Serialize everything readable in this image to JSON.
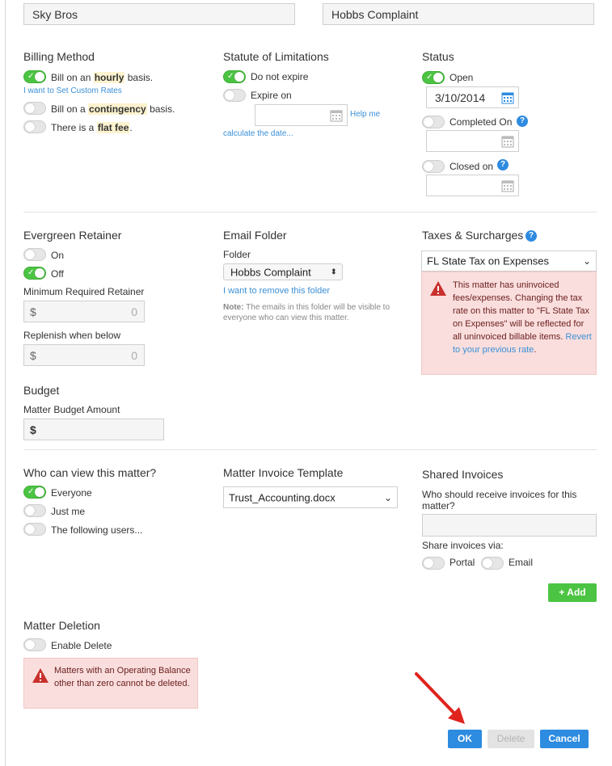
{
  "top": {
    "client_value": "Sky Bros",
    "matter_value": "Hobbs Complaint"
  },
  "billing": {
    "title": "Billing Method",
    "hourly_pre": "Bill on an",
    "hourly_kw": "hourly",
    "hourly_post": "basis.",
    "custom_rates_link": "I want to Set Custom Rates",
    "contingency_pre": "Bill on a",
    "contingency_kw": "contingency",
    "contingency_post": "basis.",
    "flat_pre": "There is a",
    "flat_kw": "flat fee",
    "flat_post": "."
  },
  "statute": {
    "title": "Statute of Limitations",
    "do_not_expire": "Do not expire",
    "expire_on": "Expire on",
    "help_link_1": "Help me",
    "help_link_2": "calculate the date..."
  },
  "status": {
    "title": "Status",
    "open_label": "Open",
    "open_date": "3/10/2014",
    "completed_label": "Completed On",
    "closed_label": "Closed on"
  },
  "evergreen": {
    "title": "Evergreen Retainer",
    "on_label": "On",
    "off_label": "Off",
    "min_label": "Minimum Required Retainer",
    "min_currency": "$",
    "min_value": "0",
    "replenish_label": "Replenish when below",
    "rep_currency": "$",
    "rep_value": "0"
  },
  "email_folder": {
    "title": "Email Folder",
    "folder_label": "Folder",
    "folder_value": "Hobbs Complaint",
    "remove_link": "I want to remove this folder",
    "note_bold": "Note:",
    "note_text": "The emails in this folder will be visible to everyone who can view this matter."
  },
  "taxes": {
    "title": "Taxes & Surcharges",
    "selected": "FL State Tax on Expenses",
    "warning_text": "This matter has uninvoiced fees/expenses. Changing the tax rate on this matter to \"FL State Tax on Expenses\" will be reflected for all uninvoiced billable items.",
    "warning_link": "Revert to your previous rate",
    "warning_end": "."
  },
  "budget": {
    "title": "Budget",
    "amount_label": "Matter Budget Amount",
    "currency": "$"
  },
  "visibility": {
    "title": "Who can view this matter?",
    "everyone": "Everyone",
    "just_me": "Just me",
    "following": "The following users..."
  },
  "invoice_template": {
    "title": "Matter Invoice Template",
    "selected": "Trust_Accounting.docx"
  },
  "shared_invoices": {
    "title": "Shared Invoices",
    "question": "Who should receive invoices for this matter?",
    "share_via": "Share invoices via:",
    "portal": "Portal",
    "email": "Email",
    "add_button": "+ Add"
  },
  "deletion": {
    "title": "Matter Deletion",
    "enable": "Enable Delete",
    "warning": "Matters with an Operating Balance other than zero cannot be deleted."
  },
  "footer": {
    "ok": "OK",
    "delete": "Delete",
    "cancel": "Cancel"
  },
  "colors": {
    "toggle_on": "#4cc443",
    "link": "#3a8fd6",
    "warning_bg": "#f9dedd",
    "primary_button": "#2d8be0",
    "add_button": "#4cc443",
    "arrow": "#e0231d"
  }
}
